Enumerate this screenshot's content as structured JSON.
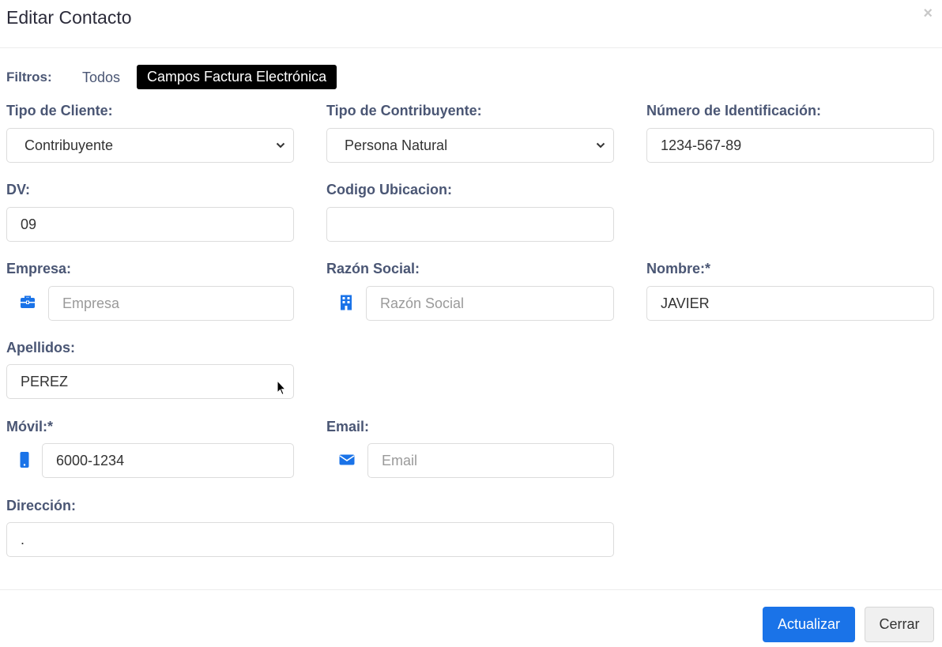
{
  "dialog": {
    "title": "Editar Contacto",
    "close_symbol": "×"
  },
  "filters": {
    "label": "Filtros:",
    "options": [
      "Todos",
      "Campos Factura Electrónica"
    ],
    "active": "Campos Factura Electrónica"
  },
  "fields": {
    "tipo_cliente": {
      "label": "Tipo de Cliente:",
      "value": "Contribuyente"
    },
    "tipo_contribuyente": {
      "label": "Tipo de Contribuyente:",
      "value": "Persona Natural"
    },
    "numero_identificacion": {
      "label": "Número de Identificación:",
      "value": "1234-567-89"
    },
    "dv": {
      "label": "DV:",
      "value": "09"
    },
    "codigo_ubicacion": {
      "label": "Codigo Ubicacion:",
      "value": ""
    },
    "empresa": {
      "label": "Empresa:",
      "value": "",
      "placeholder": "Empresa",
      "icon": "briefcase-icon"
    },
    "razon_social": {
      "label": "Razón Social:",
      "value": "",
      "placeholder": "Razón Social",
      "icon": "building-icon"
    },
    "nombre": {
      "label": "Nombre:*",
      "value": "JAVIER"
    },
    "apellidos": {
      "label": "Apellidos:",
      "value": "PEREZ"
    },
    "movil": {
      "label": "Móvil:*",
      "value": "6000-1234",
      "icon": "mobile-phone-icon"
    },
    "email": {
      "label": "Email:",
      "value": "",
      "placeholder": "Email",
      "icon": "envelope-icon"
    },
    "direccion": {
      "label": "Dirección:",
      "value": "."
    }
  },
  "footer": {
    "update_label": "Actualizar",
    "close_label": "Cerrar"
  },
  "colors": {
    "accent": "#1a73e8",
    "label": "#4a5674",
    "icon": "#1a73e8"
  }
}
